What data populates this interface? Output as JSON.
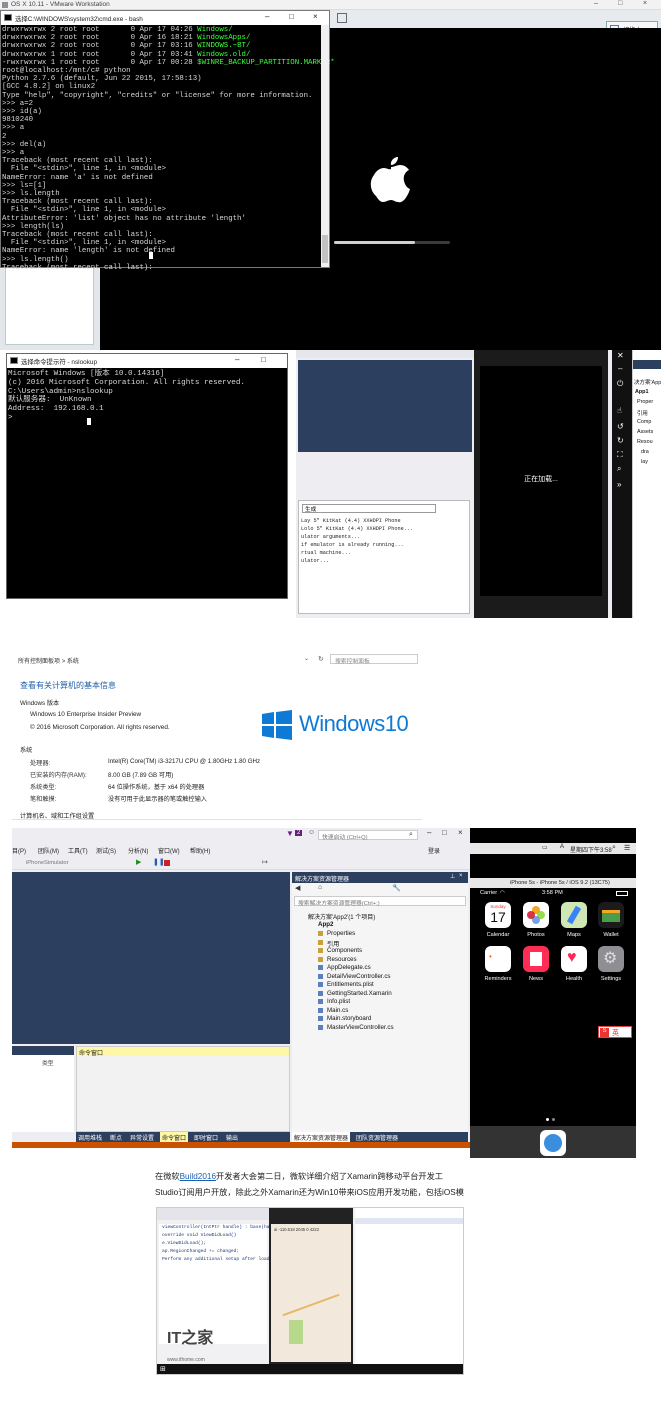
{
  "vmware": {
    "title": "OS X 10.11 - VMware Workstation",
    "right_button": "切换上一"
  },
  "bash": {
    "title": "选择C:\\WINDOWS\\system32\\cmd.exe - bash",
    "ls": [
      {
        "perm": "drwxrwxrwx 2 root root       0 Apr 17 04:26 ",
        "name": "Windows/"
      },
      {
        "perm": "drwxrwxrwx 2 root root       0 Apr 16 18:21 ",
        "name": "WindowsApps/"
      },
      {
        "perm": "drwxrwxrwx 2 root root       0 Apr 17 03:16 ",
        "name": "WINDOWS.~BT/"
      },
      {
        "perm": "drwxrwxrwx 1 root root       0 Apr 17 03:41 ",
        "name": "Windows.old/"
      },
      {
        "perm": "-rwxrwxrwx 1 root root       0 Apr 17 00:28 ",
        "name": "$WINRE_BACKUP_PARTITION.MARKER*"
      }
    ],
    "lines": [
      "root@localhost:/mnt/c# python",
      "Python 2.7.6 (default, Jun 22 2015, 17:58:13)",
      "[GCC 4.8.2] on linux2",
      "Type \"help\", \"copyright\", \"credits\" or \"license\" for more information.",
      ">>> a=2",
      ">>> id(a)",
      "9810240",
      ">>> a",
      "2",
      ">>> del(a)",
      ">>> a",
      "Traceback (most recent call last):",
      "  File \"<stdin>\", line 1, in <module>",
      "NameError: name 'a' is not defined",
      ">>> ls=[1]",
      ">>> ls.length",
      "Traceback (most recent call last):",
      "  File \"<stdin>\", line 1, in <module>",
      "AttributeError: 'list' object has no attribute 'length'",
      ">>> length(ls)",
      "Traceback (most recent call last):",
      "  File \"<stdin>\", line 1, in <module>",
      "NameError: name 'length' is not defined",
      ">>> ls.length()",
      "Traceback (most recent call last):"
    ]
  },
  "nslookup": {
    "title": "选择命令提示符 - nslookup",
    "lines": [
      "Microsoft Windows [版本 10.0.14316]",
      "(c) 2016 Microsoft Corporation. All rights reserved.",
      "",
      "C:\\Users\\admin>nslookup",
      "默认服务器:  UnKnown",
      "Address:  192.168.0.1",
      "",
      "> "
    ]
  },
  "emulator": {
    "output_label": "生成",
    "output_lines": [
      "Lay 5\" KitKat (4.4) XXHDPI Phone",
      "Lolo 5\" KitKat (4.4) XXHDPI Phone...",
      "ulator arguments...",
      "if emulator is already running...",
      "rtual machine...",
      "ulator..."
    ],
    "loading": "正在加载...",
    "solution_header": "决方案'App'",
    "tree": [
      "App1",
      "Proper",
      "引用",
      "Comp",
      "Assets",
      "Resou",
      "dra",
      "lay"
    ]
  },
  "sysinfo": {
    "breadcrumb": [
      "所有控制面板项",
      "系统"
    ],
    "search_placeholder": "搜索控制面板",
    "heading": "查看有关计算机的基本信息",
    "edition_title": "Windows 版本",
    "edition": "Windows 10 Enterprise Insider Preview",
    "copyright": "© 2016 Microsoft Corporation. All rights reserved.",
    "logo_text": "Windows10",
    "system_title": "系统",
    "rows": [
      {
        "k": "处理器:",
        "v": "Intel(R) Core(TM) i3-3217U CPU @ 1.80GHz   1.80 GHz"
      },
      {
        "k": "已安装的内存(RAM):",
        "v": "8.00 GB (7.89 GB 可用)"
      },
      {
        "k": "系统类型:",
        "v": "64 位操作系统，基于 x64 的处理器"
      },
      {
        "k": "笔和触摸:",
        "v": "没有可用于此显示器的笔或触控输入"
      }
    ],
    "footer": "计算机名、域和工作组设置"
  },
  "vs": {
    "badge": "2",
    "quicklaunch": "快速启动 (Ctrl+Q)",
    "menu": [
      "目(P)",
      "团队(M)",
      "工具(T)",
      "测试(S)",
      "分析(N)",
      "窗口(W)",
      "帮助(H)"
    ],
    "login": "登录",
    "target": "iPhoneSimulator",
    "sol_explorer_title": "解决方案资源管理器",
    "sol_search": "搜索解决方案资源管理器(Ctrl+;)",
    "sol_root": "解决方案'App2'(1 个项目)",
    "project": "App2",
    "items": [
      "Properties",
      "引用",
      "Components",
      "Resources",
      "AppDelegate.cs",
      "DetailViewController.cs",
      "Entitlements.plist",
      "GettingStarted.Xamarin",
      "Info.plist",
      "Main.cs",
      "Main.storyboard",
      "MasterViewController.cs"
    ],
    "cmd_title": "命令窗口",
    "bottom_tabs": [
      "调用堆栈",
      "断点",
      "异常设置",
      "命令窗口",
      "即时窗口",
      "输出"
    ],
    "right_tabs": [
      "解决方案资源管理器",
      "团队资源管理器"
    ],
    "left_label": "类型",
    "bottom_right": "发布"
  },
  "ios": {
    "menubar_time": "星期四下午3:58",
    "sim_title": "iPhone 5s - iPhone 5s / iOS 9.2 (13C75)",
    "carrier": "Carrier",
    "time": "3:58 PM",
    "day": "Sunday",
    "date": "17",
    "apps": [
      "Calendar",
      "Photos",
      "Maps",
      "Wallet",
      "Reminders",
      "News",
      "Health",
      "Settings"
    ],
    "ime": "英"
  },
  "article": {
    "prefix": "在微软",
    "link": "Build2016",
    "line1_rest": "开发者大会第二日，微软详细介绍了Xamarin跨移动平台开发工",
    "line2": "Studio订阅用户开放，除此之外Xamarin还为Win10带来iOS应用开发功能，包括iOS模"
  },
  "thumb": {
    "code": [
      "viewController(IntPtr handle) : base(han",
      "",
      "override void ViewDidLoad()",
      "",
      "e.ViewDidLoad();",
      "ap.RegionChanged += changed;",
      "Perform any additional setup after loadi"
    ],
    "coord": "ai -110.618 2045 0 4222",
    "watermark": "IT之家",
    "watermark_url": "www.ithome.com"
  },
  "colors": {
    "vs_blue": "#2d3f5e",
    "vs_orange": "#ca5100",
    "terminal": "#000000",
    "link": "#1a5fb4",
    "win_blue": "#0f7ad6"
  }
}
